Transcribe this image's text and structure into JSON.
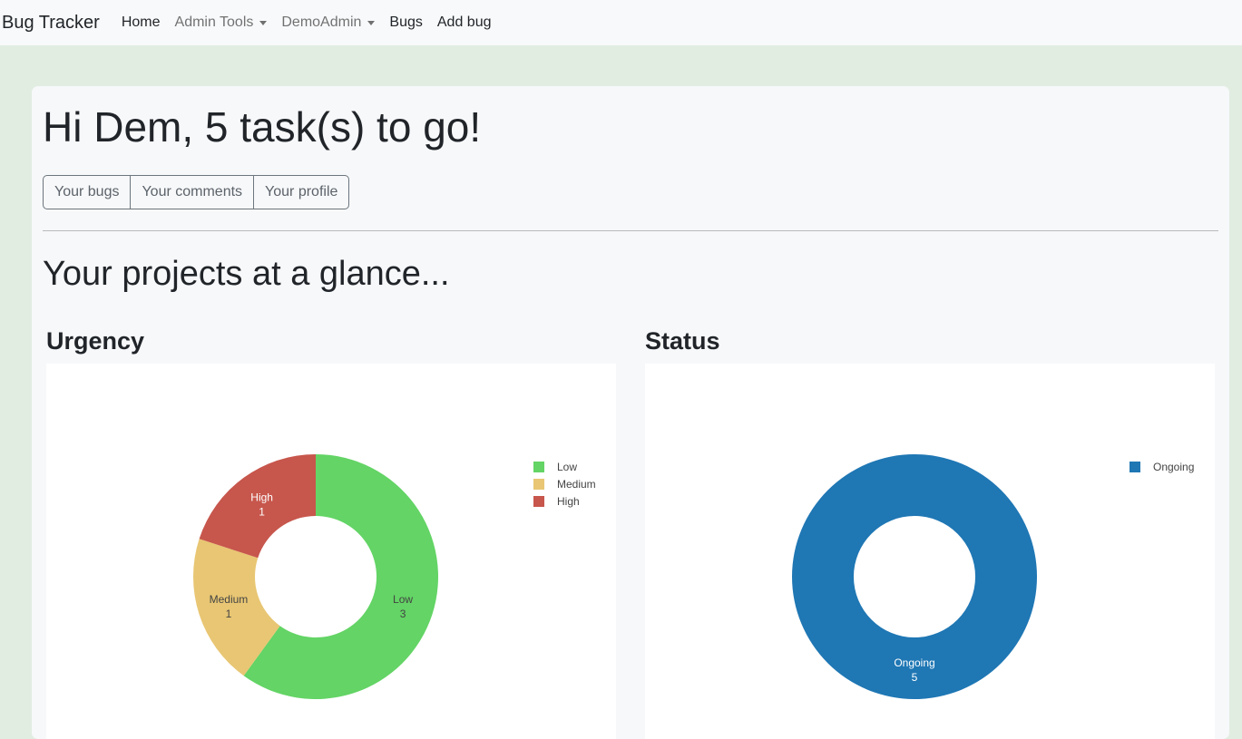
{
  "navbar": {
    "brand": "Bug Tracker",
    "items": [
      {
        "label": "Home",
        "dropdown": false
      },
      {
        "label": "Admin Tools",
        "dropdown": true
      },
      {
        "label": "DemoAdmin",
        "dropdown": true
      },
      {
        "label": "Bugs",
        "dropdown": false
      },
      {
        "label": "Add bug",
        "dropdown": false
      }
    ]
  },
  "main": {
    "greeting": "Hi Dem, 5 task(s) to go!",
    "buttons": [
      "Your bugs",
      "Your comments",
      "Your profile"
    ],
    "section_title": "Your projects at a glance..."
  },
  "colors": {
    "page_background": "#e1ede1",
    "card_background": "#f7f8fa",
    "low": "#63d465",
    "medium": "#e8c673",
    "high": "#c7564c",
    "ongoing": "#1f77b4"
  },
  "chart_data": [
    {
      "type": "pie",
      "hole": true,
      "title": "Urgency",
      "categories": [
        "Low",
        "Medium",
        "High"
      ],
      "values": [
        3,
        1,
        1
      ],
      "colors": [
        "#63d465",
        "#e8c673",
        "#c7564c"
      ],
      "legend": [
        "Low",
        "Medium",
        "High"
      ],
      "legend_position": "top-right"
    },
    {
      "type": "pie",
      "hole": true,
      "title": "Status",
      "categories": [
        "Ongoing"
      ],
      "values": [
        5
      ],
      "colors": [
        "#1f77b4"
      ],
      "legend": [
        "Ongoing"
      ],
      "legend_position": "top-right"
    }
  ]
}
